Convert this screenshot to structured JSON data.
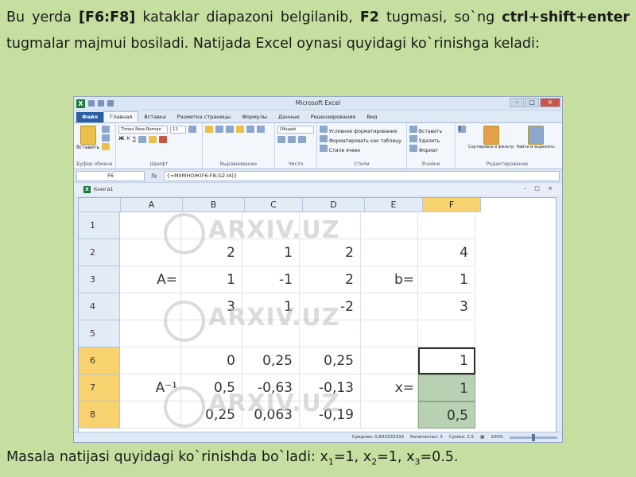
{
  "paragraph": {
    "part1": "Bu yerda ",
    "range": "[F6:F8]",
    "part2": " kataklar diapazoni belgilanib, ",
    "key": "F2",
    "part3": " tugmasi, so`ng ",
    "combo": "ctrl+shift+enter",
    "part4": " tugmalar majmui bosiladi. Natijada Excel oynasi quyidagi ko`rinishga keladi:"
  },
  "bottom_text": {
    "prefix": "Masala natijasi quyidagi ko`rinishda bo`ladi:",
    "x1_label": "x",
    "x1_sub": "1",
    "x1_value": "=1,",
    "x2_label": "x",
    "x2_sub": "2",
    "x2_value": "=1,",
    "x3_label": "x",
    "x3_sub": "3",
    "x3_value": "=0.5."
  },
  "excel": {
    "window_title": "Microsoft Excel",
    "tabs": [
      "Файл",
      "Главная",
      "Вставка",
      "Разметка страницы",
      "Формулы",
      "Данные",
      "Рецензирование",
      "Вид"
    ],
    "ribbon": {
      "paste": "Вставить",
      "font_name": "Times New Roman",
      "font_size": "11",
      "number_format": "Общий",
      "cond_format": "Условное форматирование",
      "format_table": "Форматировать как таблицу",
      "cell_styles": "Стили ячеек",
      "insert": "Вставить",
      "delete": "Удалить",
      "format": "Формат",
      "sort": "Сортировка и фильтр",
      "find": "Найти и выделить",
      "groups": [
        "Буфер обмена",
        "Шрифт",
        "Выравнивание",
        "Число",
        "Стили",
        "Ячейки",
        "Редактирование"
      ]
    },
    "name_box": "F6",
    "fx": "fx",
    "formula": "{=МУМНОЖ(F6:F8;G2:I4)}",
    "workbook_title": "Книга1",
    "columns": [
      "A",
      "B",
      "C",
      "D",
      "E",
      "F"
    ],
    "rows": [
      {
        "num": "1",
        "cells": [
          "",
          "",
          "",
          "",
          "",
          ""
        ]
      },
      {
        "num": "2",
        "cells": [
          "",
          "2",
          "1",
          "2",
          "",
          "4"
        ]
      },
      {
        "num": "3",
        "cells": [
          "A=",
          "1",
          "-1",
          "2",
          "b=",
          "1"
        ]
      },
      {
        "num": "4",
        "cells": [
          "",
          "3",
          "1",
          "-2",
          "",
          "3"
        ]
      },
      {
        "num": "5",
        "cells": [
          "",
          "",
          "",
          "",
          "",
          ""
        ]
      },
      {
        "num": "6",
        "cells": [
          "",
          "0",
          "0,25",
          "0,25",
          "",
          "1"
        ]
      },
      {
        "num": "7",
        "cells": [
          "A⁻¹",
          "0,5",
          "-0,63",
          "-0,13",
          "x=",
          "1"
        ]
      },
      {
        "num": "8",
        "cells": [
          "",
          "0,25",
          "0,063",
          "-0,19",
          "",
          "0,5"
        ]
      }
    ],
    "status": {
      "average": "Среднее: 0,833333333",
      "count": "Количество: 3",
      "sum": "Сумма: 2,5",
      "zoom": "100%"
    }
  },
  "watermark": "ARXIV.UZ"
}
